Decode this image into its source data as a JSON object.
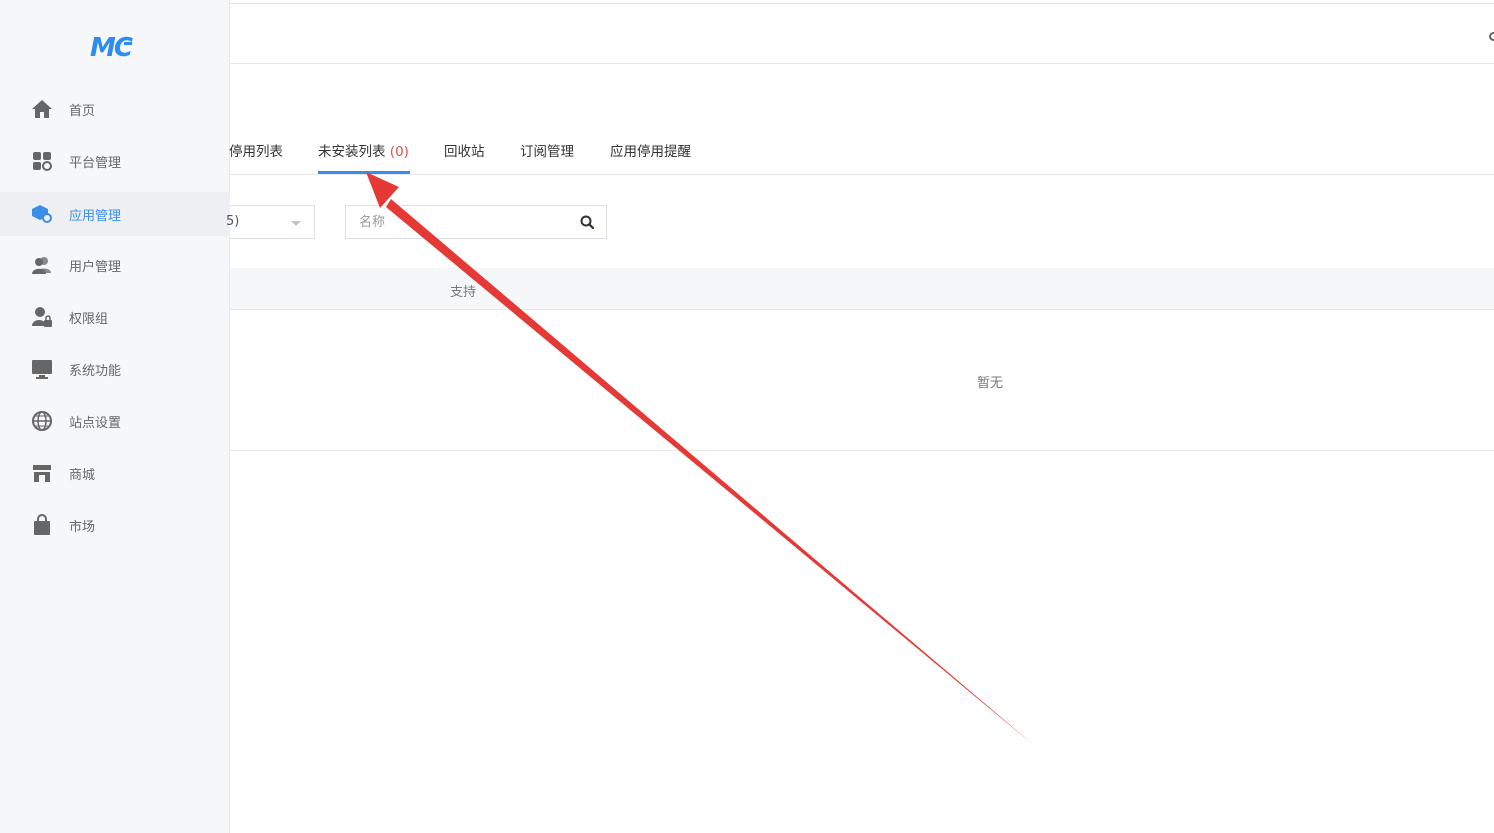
{
  "logo": {
    "text": "MC",
    "color": "#2d8cf0"
  },
  "sidebar": {
    "items": [
      {
        "label": "首页",
        "icon": "home-icon"
      },
      {
        "label": "平台管理",
        "icon": "grid-gear-icon"
      },
      {
        "label": "应用管理",
        "icon": "cube-gear-icon",
        "active": true
      },
      {
        "label": "用户管理",
        "icon": "users-icon"
      },
      {
        "label": "权限组",
        "icon": "user-lock-icon"
      },
      {
        "label": "系统功能",
        "icon": "monitor-icon"
      },
      {
        "label": "站点设置",
        "icon": "globe-icon"
      },
      {
        "label": "商城",
        "icon": "store-icon"
      },
      {
        "label": "市场",
        "icon": "bag-icon"
      }
    ]
  },
  "tabs": [
    {
      "label": "停用列表"
    },
    {
      "label": "未安装列表",
      "count": "(0)",
      "active": true
    },
    {
      "label": "回收站"
    },
    {
      "label": "订阅管理"
    },
    {
      "label": "应用停用提醒"
    }
  ],
  "filter": {
    "select_value": "5)",
    "search_placeholder": "名称"
  },
  "table": {
    "column_header": "支持",
    "empty_text": "暂无"
  },
  "colors": {
    "accent": "#3a8ee6",
    "count": "#d9534f",
    "annotation_arrow": "#e53935"
  }
}
